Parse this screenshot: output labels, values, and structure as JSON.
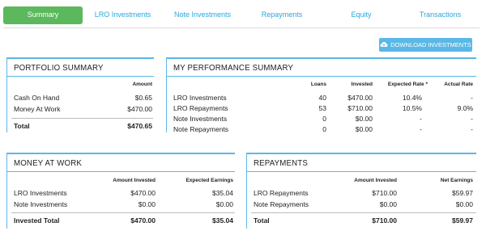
{
  "tabs": [
    {
      "label": "Summary",
      "active": true
    },
    {
      "label": "LRO Investments",
      "active": false
    },
    {
      "label": "Note Investments",
      "active": false
    },
    {
      "label": "Repayments",
      "active": false
    },
    {
      "label": "Equity",
      "active": false
    },
    {
      "label": "Transactions",
      "active": false
    }
  ],
  "download_button": {
    "label": "DOWNLOAD INVESTMENTS",
    "icon": "cloud-download-icon"
  },
  "portfolio_summary": {
    "title": "PORTFOLIO SUMMARY",
    "col_amount": "Amount",
    "rows": [
      {
        "label": "Cash On Hand",
        "amount": "$0.65"
      },
      {
        "label": "Money At Work",
        "amount": "$470.00"
      }
    ],
    "total": {
      "label": "Total",
      "amount": "$470.65"
    }
  },
  "performance_summary": {
    "title": "MY PERFORMANCE SUMMARY",
    "col_loans": "Loans",
    "col_invested": "Invested",
    "col_expected": "Expected Rate *",
    "col_actual": "Actual Rate",
    "rows": [
      {
        "label": "LRO Investments",
        "loans": "40",
        "invested": "$470.00",
        "expected": "10.4%",
        "actual": "-"
      },
      {
        "label": "LRO Repayments",
        "loans": "53",
        "invested": "$710.00",
        "expected": "10.5%",
        "actual": "9.0%"
      },
      {
        "label": "Note Investments",
        "loans": "0",
        "invested": "$0.00",
        "expected": "-",
        "actual": "-"
      },
      {
        "label": "Note Repayments",
        "loans": "0",
        "invested": "$0.00",
        "expected": "-",
        "actual": "-"
      }
    ]
  },
  "money_at_work": {
    "title": "MONEY AT WORK",
    "col_invested": "Amount Invested",
    "col_earnings": "Expected Earnings",
    "rows": [
      {
        "label": "LRO Investments",
        "invested": "$470.00",
        "earnings": "$35.04"
      },
      {
        "label": "Note Investments",
        "invested": "$0.00",
        "earnings": "$0.00"
      }
    ],
    "total": {
      "label": "Invested Total",
      "invested": "$470.00",
      "earnings": "$35.04"
    }
  },
  "repayments": {
    "title": "REPAYMENTS",
    "col_invested": "Amount Invested",
    "col_earnings": "Net Earnings",
    "rows": [
      {
        "label": "LRO Repayments",
        "invested": "$710.00",
        "earnings": "$59.97"
      },
      {
        "label": "Note Repayments",
        "invested": "$0.00",
        "earnings": "$0.00"
      }
    ],
    "total": {
      "label": "Total",
      "invested": "$710.00",
      "earnings": "$59.97"
    }
  },
  "colors": {
    "accent": "#5bb8e6",
    "active_tab": "#5cb85c",
    "tab_text": "#29a6dc"
  }
}
